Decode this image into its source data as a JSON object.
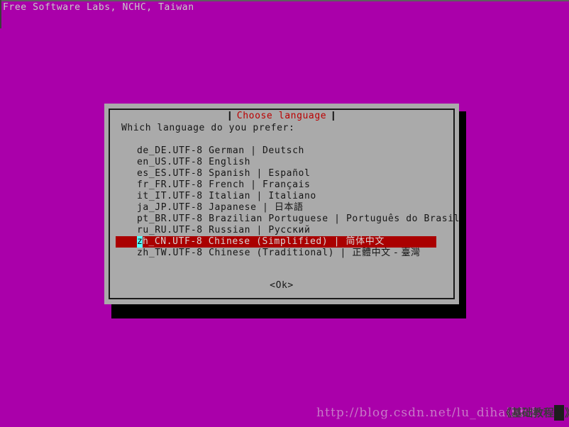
{
  "banner": {
    "text": "Free Software Labs, NCHC, Taiwan"
  },
  "dialog": {
    "title": "Choose language",
    "prompt": "Which language do you prefer:",
    "ok_label": "<Ok>",
    "selected_index": 8,
    "cursor_char": "z",
    "languages": [
      {
        "locale": "de_DE.UTF-8",
        "english": "German",
        "sep": "|",
        "native": "Deutsch"
      },
      {
        "locale": "en_US.UTF-8",
        "english": "English",
        "sep": "",
        "native": ""
      },
      {
        "locale": "es_ES.UTF-8",
        "english": "Spanish",
        "sep": "|",
        "native": "Español"
      },
      {
        "locale": "fr_FR.UTF-8",
        "english": "French",
        "sep": "|",
        "native": "Français"
      },
      {
        "locale": "it_IT.UTF-8",
        "english": "Italian",
        "sep": "|",
        "native": "Italiano"
      },
      {
        "locale": "ja_JP.UTF-8",
        "english": "Japanese",
        "sep": "|",
        "native": "日本語"
      },
      {
        "locale": "pt_BR.UTF-8",
        "english": "Brazilian Portuguese",
        "sep": "|",
        "native": "Português do Brasil"
      },
      {
        "locale": "ru_RU.UTF-8",
        "english": "Russian",
        "sep": "|",
        "native": "Русский"
      },
      {
        "locale": "zh_CN.UTF-8",
        "english": "Chinese (Simplified)",
        "sep": "|",
        "native": "简体中文"
      },
      {
        "locale": "zh_TW.UTF-8",
        "english": "Chinese (Traditional)",
        "sep": "|",
        "native": "正體中文 - 臺灣"
      }
    ]
  },
  "watermark": {
    "url": "http://blog.csdn.net/lu_dihaibbd",
    "chinese": "《基础教程网》"
  },
  "colors": {
    "background": "#aa00aa",
    "dialog": "#aaaaaa",
    "title": "#bb0000",
    "selection": "#aa0000",
    "cursor": "#55ffff",
    "text": "#161616",
    "banner_text": "#c8c8c8"
  }
}
